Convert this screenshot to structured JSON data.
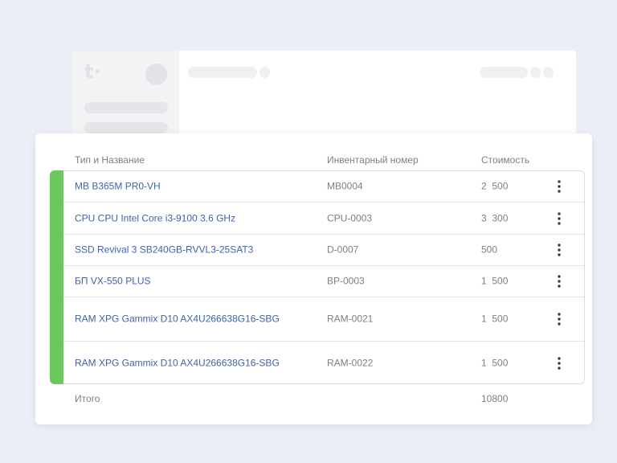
{
  "background_app": {
    "logo": "t·"
  },
  "table": {
    "headers": {
      "name": "Тип и Название",
      "inventory": "Инвентарный номер",
      "cost": "Стоимость"
    },
    "rows": [
      {
        "name": "MB B365M PR0-VH",
        "inventory": "MB0004",
        "cost": "2  500"
      },
      {
        "name": "CPU CPU Intel Core i3-9100 3.6 GHz",
        "inventory": "CPU-0003",
        "cost": "3  300"
      },
      {
        "name": "SSD Revival 3 SB240GB-RVVL3-25SAT3",
        "inventory": "D-0007",
        "cost": "500"
      },
      {
        "name": "БП VX-550 PLUS",
        "inventory": "BP-0003",
        "cost": "1  500"
      },
      {
        "name": "RAM XPG Gammix D10 AX4U266638G16-SBG",
        "inventory": "RAM-0021",
        "cost": "1  500"
      },
      {
        "name": "RAM XPG Gammix D10 AX4U266638G16-SBG",
        "inventory": "RAM-0022",
        "cost": "1  500"
      }
    ],
    "row_menu_icon": "more-vertical-icon",
    "total": {
      "label": "Итого",
      "value": "10800"
    }
  },
  "colors": {
    "accent": "#6cc75e",
    "link": "#3f64ac",
    "muted_text": "#7d7f86",
    "page_background": "#eceef7"
  }
}
